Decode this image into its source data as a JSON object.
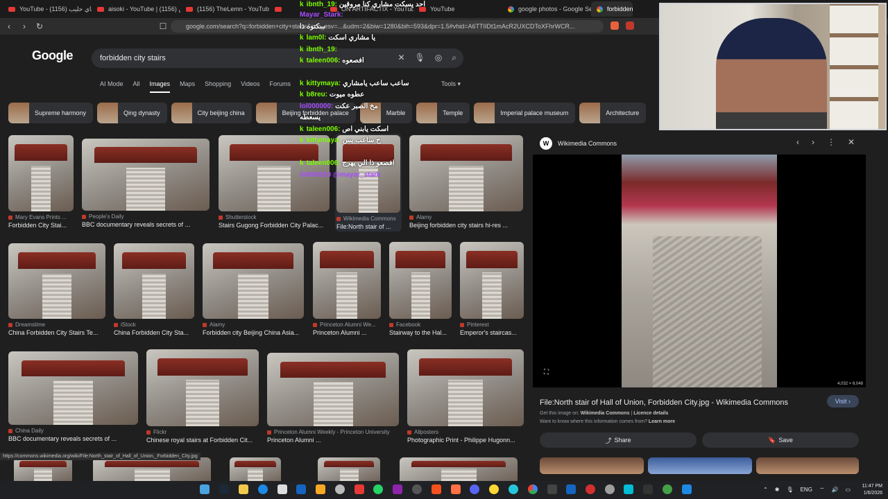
{
  "tabs": [
    {
      "label": "YouTube - شاي حليب (1156)",
      "icon": "youtube-icon"
    },
    {
      "label": "aisoki - YouTube | زين (1156)",
      "icon": "youtube-icon"
    },
    {
      "label": "(1156) TheLemn - YouTube",
      "icon": "youtube-icon"
    },
    {
      "label": "",
      "icon": "youtube-icon"
    },
    {
      "label": "ON ARTIFACTIX - YouTube",
      "icon": "youtube-icon"
    },
    {
      "label": "YouTube",
      "icon": "youtube-icon"
    },
    {
      "label": "google photos - Google Sear",
      "icon": "google-icon"
    },
    {
      "label": "forbidden",
      "icon": "google-icon"
    }
  ],
  "address": "google.com/search?q=forbidden+city+stairs&sca_esv=...&udm=2&biw=1280&bih=593&dpr=1.5#vhid=A6TTIIDt1mAcR2UXCDToXFhrWCR...",
  "logo": "Google",
  "search": {
    "query": "forbidden city stairs"
  },
  "nav_tabs": [
    "AI Mode",
    "All",
    "Images",
    "Maps",
    "Shopping",
    "Videos",
    "Forums"
  ],
  "tools_label": "Tools ▾",
  "chips": [
    "Supreme harmony",
    "Qing dynasty",
    "City beijing china",
    "Beijing forbidden palace",
    "Marble",
    "Temple",
    "Imperial palace museum",
    "Architecture"
  ],
  "results": [
    {
      "source": "Mary Evans Prints ...",
      "caption": "Forbidden City Stai..."
    },
    {
      "source": "People's Daily",
      "caption": "BBC documentary reveals secrets of ..."
    },
    {
      "source": "Shutterstock",
      "caption": "Stairs Gugong Forbidden City Palac..."
    },
    {
      "source": "Wikimedia Commons",
      "caption": "File:North stair of ..."
    },
    {
      "source": "Alamy",
      "caption": "Beijing forbidden city stairs hi-res ..."
    },
    {
      "source": "Dreamstime",
      "caption": "China Forbidden City Stairs Te..."
    },
    {
      "source": "iStock",
      "caption": "China Forbidden City Sta..."
    },
    {
      "source": "Alamy",
      "caption": "Forbidden city Beijing China Asia..."
    },
    {
      "source": "Princeton Alumni We...",
      "caption": "Princeton Alumni ..."
    },
    {
      "source": "Facebook",
      "caption": "Stairway to the Hal..."
    },
    {
      "source": "Pinterest",
      "caption": "Emperor's staircas..."
    },
    {
      "source": "China Daily",
      "caption": "BBC documentary reveals secrets of ..."
    },
    {
      "source": "Flickr",
      "caption": "Chinese royal stairs at Forbidden Cit..."
    },
    {
      "source": "Princeton Alumni Weekly - Princeton University",
      "caption": "Princeton Alumni ..."
    },
    {
      "source": "Allposters",
      "caption": "Photographic Print - Philippe Hugonn..."
    }
  ],
  "panel": {
    "site": "Wikimedia Commons",
    "dims": "4,032 × 6,048",
    "title": "File:North stair of Hall of Union, Forbidden City.jpg - Wikimedia Commons",
    "visit": "Visit ›",
    "license_prefix": "Get this image on:",
    "license_site": "Wikimedia Commons",
    "license_link": "Licence details",
    "want": "Want to know where this information comes from?",
    "learn": "Learn more",
    "share": "Share",
    "save": "Save"
  },
  "status_url": "https://commons.wikimedia.org/wiki/File:North_stair_of_Hall_of_Union,_Forbidden_City.jpg",
  "chat": [
    {
      "user": "",
      "text": "احد يسكت مشاري كنا مروقين"
    },
    {
      "user": "ibnth_19:",
      "text": ""
    },
    {
      "user": "Mayar_Stark:",
      "text": ""
    },
    {
      "user": "",
      "text": "سكتوه ذا"
    },
    {
      "user": "lam0l:",
      "text": "يا مشاري اسكت"
    },
    {
      "user": "ibnth_19:",
      "text": ""
    },
    {
      "user": "taleen006:",
      "text": "افصعوه"
    },
    {
      "user": "kittymaya:",
      "text": "ساعب ساعب يامشاري"
    },
    {
      "user": "b8reu:",
      "text": "عطوه ميوت"
    },
    {
      "user": "lol000000:",
      "text": "مخ الصبر عكت"
    },
    {
      "user": "",
      "text": "يسعطه"
    },
    {
      "user": "taleen006:",
      "text": "اسكت يابني اص"
    },
    {
      "user": "kittymaya:",
      "text": "ح ساعب يس"
    },
    {
      "user": "taleen006:",
      "text": "افصعو ذا الي يهرج"
    },
    {
      "user": "lol000010",
      "text": "@mayar_stark"
    }
  ],
  "tray": {
    "lang": "ENG",
    "time": "11:47 PM",
    "date": "1/6/2026"
  }
}
